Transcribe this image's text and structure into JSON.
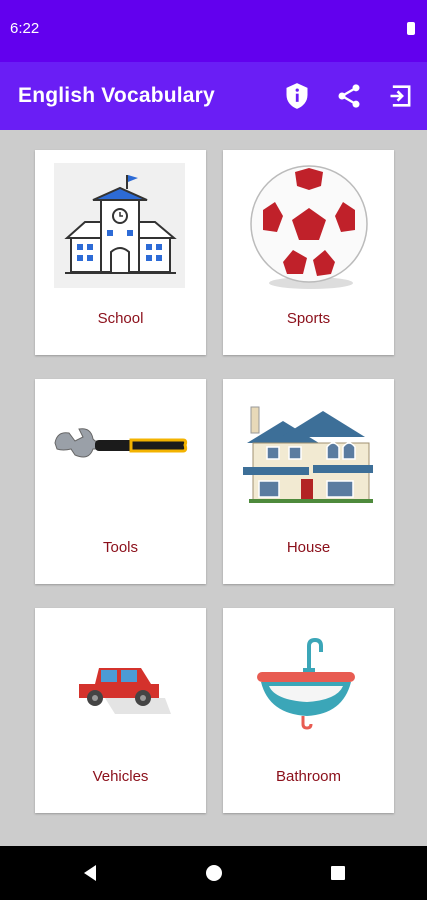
{
  "status_bar": {
    "time": "6:22"
  },
  "app_bar": {
    "title": "English Vocabulary",
    "actions": [
      "info-icon",
      "share-icon",
      "exit-icon"
    ]
  },
  "categories": [
    {
      "label": "School",
      "icon": "school-building-icon"
    },
    {
      "label": "Sports",
      "icon": "soccer-ball-icon"
    },
    {
      "label": "Tools",
      "icon": "wrench-icon"
    },
    {
      "label": "House",
      "icon": "house-icon"
    },
    {
      "label": "Vehicles",
      "icon": "car-icon"
    },
    {
      "label": "Bathroom",
      "icon": "sink-icon"
    }
  ],
  "colors": {
    "status_bar": "#6200ee",
    "app_bar": "#6a1ef5",
    "label": "#8b0f1a",
    "background": "#cccccc"
  },
  "nav_bar": {
    "buttons": [
      "back-icon",
      "home-icon",
      "recents-icon"
    ]
  }
}
